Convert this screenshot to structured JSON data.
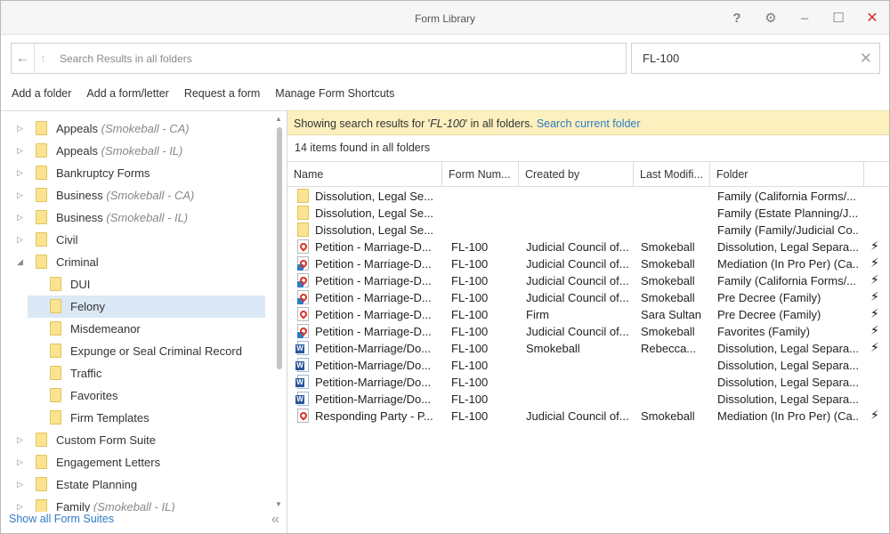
{
  "window": {
    "title": "Form Library"
  },
  "titlebar": {
    "help": "?",
    "settings": "⚙",
    "minimize": "–",
    "maximize": "☐",
    "close": "✕"
  },
  "search": {
    "placeholder": "Search Results in all folders",
    "query": "FL-100"
  },
  "toolbar": {
    "items": [
      "Add a folder",
      "Add a form/letter",
      "Request a form",
      "Manage Form Shortcuts"
    ]
  },
  "tree": {
    "items": [
      {
        "label": "Appeals",
        "qualifier": "(Smokeball - CA)",
        "level": 0,
        "expander": "▷"
      },
      {
        "label": "Appeals",
        "qualifier": "(Smokeball - IL)",
        "level": 0,
        "expander": "▷"
      },
      {
        "label": "Bankruptcy Forms",
        "qualifier": "",
        "level": 0,
        "expander": "▷"
      },
      {
        "label": "Business",
        "qualifier": "(Smokeball - CA)",
        "level": 0,
        "expander": "▷"
      },
      {
        "label": "Business",
        "qualifier": "(Smokeball - IL)",
        "level": 0,
        "expander": "▷"
      },
      {
        "label": "Civil",
        "qualifier": "",
        "level": 0,
        "expander": "▷"
      },
      {
        "label": "Criminal",
        "qualifier": "",
        "level": 0,
        "expander": "◢"
      },
      {
        "label": "DUI",
        "qualifier": "",
        "level": 1,
        "expander": ""
      },
      {
        "label": "Felony",
        "qualifier": "",
        "level": 1,
        "expander": "",
        "selected": true
      },
      {
        "label": "Misdemeanor",
        "qualifier": "",
        "level": 1,
        "expander": ""
      },
      {
        "label": "Expunge or Seal Criminal Record",
        "qualifier": "",
        "level": 1,
        "expander": ""
      },
      {
        "label": "Traffic",
        "qualifier": "",
        "level": 1,
        "expander": ""
      },
      {
        "label": "Favorites",
        "qualifier": "",
        "level": 1,
        "expander": ""
      },
      {
        "label": "Firm Templates",
        "qualifier": "",
        "level": 1,
        "expander": ""
      },
      {
        "label": "Custom Form Suite",
        "qualifier": "",
        "level": 0,
        "expander": "▷"
      },
      {
        "label": "Engagement Letters",
        "qualifier": "",
        "level": 0,
        "expander": "▷"
      },
      {
        "label": "Estate Planning",
        "qualifier": "",
        "level": 0,
        "expander": "▷"
      },
      {
        "label": "Family",
        "qualifier": "(Smokeball - IL)",
        "level": 0,
        "expander": "▷"
      }
    ],
    "show_all": "Show all Form Suites",
    "collapse": "«"
  },
  "results": {
    "info_prefix": "Showing search results for '",
    "info_query": "FL-100",
    "info_suffix": "' in all folders.",
    "info_link": "Search current folder",
    "count": "14 items found in all folders",
    "columns": [
      "Name",
      "Form Num...",
      "Created by",
      "Last Modifi...",
      "Folder"
    ],
    "rows": [
      {
        "icon": "folder",
        "name": "Dissolution, Legal Se...",
        "form": "",
        "created": "",
        "modified": "",
        "folder": "Family (California Forms/...",
        "shortcut": ""
      },
      {
        "icon": "folder",
        "name": "Dissolution, Legal Se...",
        "form": "",
        "created": "",
        "modified": "",
        "folder": "Family (Estate Planning/J...",
        "shortcut": ""
      },
      {
        "icon": "folder",
        "name": "Dissolution, Legal Se...",
        "form": "",
        "created": "",
        "modified": "",
        "folder": "Family (Family/Judicial Co...",
        "shortcut": ""
      },
      {
        "icon": "pdf",
        "name": "Petition - Marriage-D...",
        "form": "FL-100",
        "created": "Judicial Council of...",
        "modified": "Smokeball",
        "folder": "Dissolution, Legal Separa...",
        "shortcut": "⚡"
      },
      {
        "icon": "pdf-link",
        "name": "Petition - Marriage-D...",
        "form": "FL-100",
        "created": "Judicial Council of...",
        "modified": "Smokeball",
        "folder": "Mediation (In Pro Per) (Ca...",
        "shortcut": "⚡"
      },
      {
        "icon": "pdf-link",
        "name": "Petition - Marriage-D...",
        "form": "FL-100",
        "created": "Judicial Council of...",
        "modified": "Smokeball",
        "folder": "Family (California Forms/...",
        "shortcut": "⚡"
      },
      {
        "icon": "pdf-link",
        "name": "Petition - Marriage-D...",
        "form": "FL-100",
        "created": "Judicial Council of...",
        "modified": "Smokeball",
        "folder": "Pre Decree (Family)",
        "shortcut": "⚡"
      },
      {
        "icon": "pdf",
        "name": "Petition - Marriage-D...",
        "form": "FL-100",
        "created": "Firm",
        "modified": "Sara Sultan",
        "folder": "Pre Decree (Family)",
        "shortcut": "⚡"
      },
      {
        "icon": "pdf-link",
        "name": "Petition - Marriage-D...",
        "form": "FL-100",
        "created": "Judicial Council of...",
        "modified": "Smokeball",
        "folder": "Favorites (Family)",
        "shortcut": "⚡"
      },
      {
        "icon": "word",
        "name": "Petition-Marriage/Do...",
        "form": "FL-100",
        "created": "Smokeball",
        "modified": "Rebecca...",
        "folder": "Dissolution, Legal Separa...",
        "shortcut": "⚡"
      },
      {
        "icon": "word",
        "name": "Petition-Marriage/Do...",
        "form": "FL-100",
        "created": "",
        "modified": "",
        "folder": "Dissolution, Legal Separa...",
        "shortcut": ""
      },
      {
        "icon": "word",
        "name": "Petition-Marriage/Do...",
        "form": "FL-100",
        "created": "",
        "modified": "",
        "folder": "Dissolution, Legal Separa...",
        "shortcut": ""
      },
      {
        "icon": "word",
        "name": "Petition-Marriage/Do...",
        "form": "FL-100",
        "created": "",
        "modified": "",
        "folder": "Dissolution, Legal Separa...",
        "shortcut": ""
      },
      {
        "icon": "pdf",
        "name": "Responding Party - P...",
        "form": "FL-100",
        "created": "Judicial Council of...",
        "modified": "Smokeball",
        "folder": "Mediation (In Pro Per) (Ca...",
        "shortcut": "⚡"
      }
    ]
  },
  "colors": {
    "accent": "#2f7bc5",
    "info_bg": "#fcf0bf",
    "selected_bg": "#dbe8f6",
    "folder": "#fbe38f",
    "pdf": "#d93025",
    "word": "#2b579a",
    "close": "#d32f2f"
  }
}
